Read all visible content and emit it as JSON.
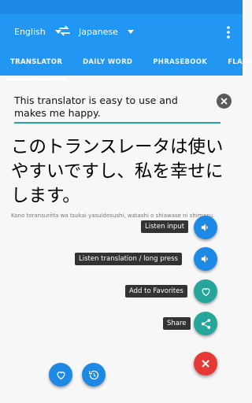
{
  "header": {
    "source_language": "English",
    "target_language": "Japanese",
    "swap_icon": "swap-arrows-icon",
    "menu_icon": "more-vert-icon"
  },
  "tabs": [
    {
      "label": "TRANSLATOR",
      "active": true
    },
    {
      "label": "DAILY WORD",
      "active": false
    },
    {
      "label": "PHRASEBOOK",
      "active": false
    },
    {
      "label": "FLASH",
      "active": false
    }
  ],
  "input": {
    "text": "This translator is easy to use and makes me happy.",
    "clear_icon": "close-icon"
  },
  "output": {
    "translation": "このトランスレータは使いやすいですし、私を幸せにします。",
    "romanization": "Kono toransurēta wa tsukai yasuidesushi, watashi o shiawase ni shimasu."
  },
  "fab_menu": [
    {
      "label": "Listen input",
      "icon": "volume-icon"
    },
    {
      "label": "Listen translation / long press",
      "icon": "volume-icon"
    },
    {
      "label": "Add to Favorites",
      "icon": "heart-outline-icon"
    },
    {
      "label": "Share",
      "icon": "share-icon"
    }
  ],
  "fab_close_icon": "close-icon",
  "bottom_actions": [
    {
      "icon": "heart-outline-icon"
    },
    {
      "icon": "history-icon"
    }
  ],
  "colors": {
    "primary": "#2196f3",
    "accent_teal": "#26a69a",
    "close_red": "#e53935"
  }
}
